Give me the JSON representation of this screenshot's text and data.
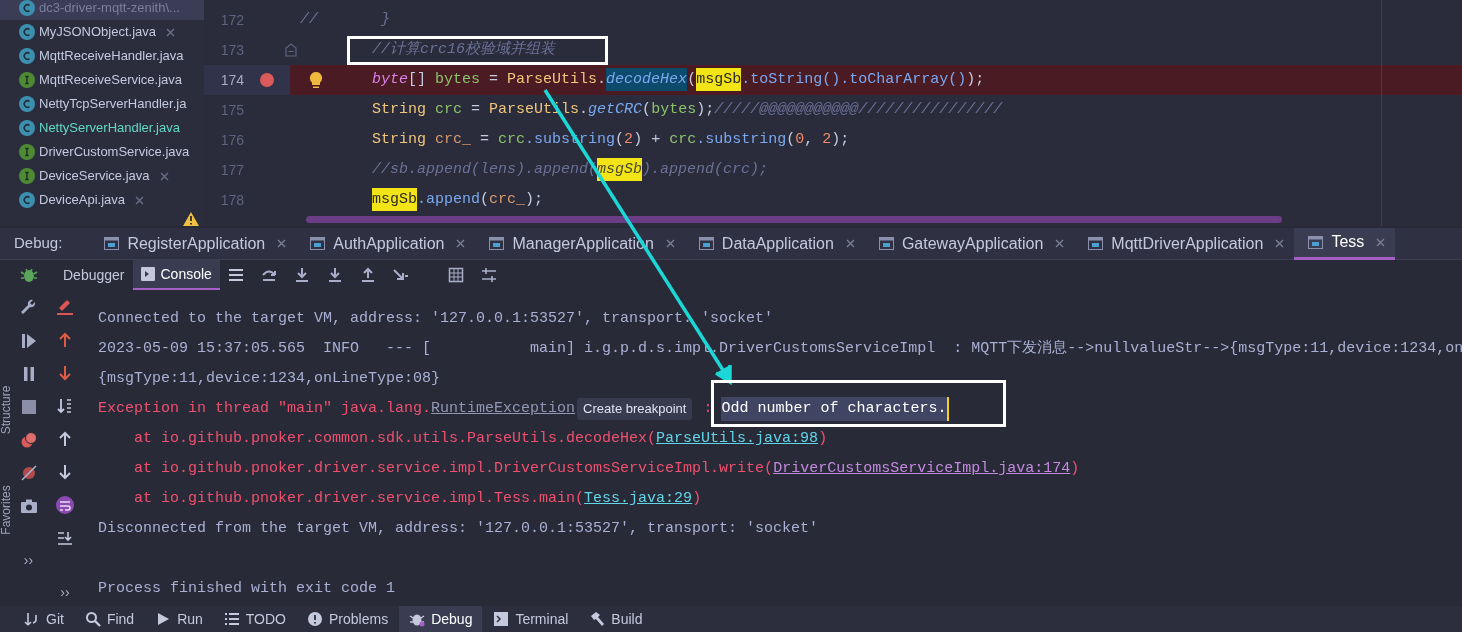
{
  "files": [
    {
      "name": "dc3-driver-mqtt-zenith\\...",
      "interface": false,
      "selected": true,
      "modified": false,
      "close": false
    },
    {
      "name": "MyJSONObject.java",
      "interface": false,
      "selected": false,
      "modified": false,
      "close": true
    },
    {
      "name": "MqttReceiveHandler.java",
      "interface": false,
      "selected": false,
      "modified": false,
      "close": false
    },
    {
      "name": "MqttReceiveService.java",
      "interface": true,
      "selected": false,
      "modified": false,
      "close": false
    },
    {
      "name": "NettyTcpServerHandler.ja",
      "interface": false,
      "selected": false,
      "modified": false,
      "close": false
    },
    {
      "name": "NettyServerHandler.java",
      "interface": false,
      "selected": false,
      "modified": true,
      "close": false
    },
    {
      "name": "DriverCustomService.java",
      "interface": true,
      "selected": false,
      "modified": false,
      "close": false
    },
    {
      "name": "DeviceService.java",
      "interface": true,
      "selected": false,
      "modified": false,
      "close": true
    },
    {
      "name": "DeviceApi.java",
      "interface": false,
      "selected": false,
      "modified": false,
      "close": true
    }
  ],
  "editor": {
    "lines": [
      {
        "number": "172",
        "breakpoint": false,
        "current": false,
        "fold": false,
        "bulb": false,
        "tokens": [
          {
            "kind": "cm",
            "text": "//       }"
          }
        ]
      },
      {
        "number": "173",
        "breakpoint": false,
        "current": false,
        "fold": true,
        "bulb": false,
        "tokens": [
          {
            "kind": "cm",
            "text": "        //计算crc16校验域并组装"
          }
        ]
      },
      {
        "number": "174",
        "breakpoint": true,
        "current": true,
        "fold": false,
        "bulb": true,
        "tokens": [
          {
            "kind": "kw",
            "text": "        byte"
          },
          {
            "kind": "p",
            "text": "[] "
          },
          {
            "kind": "var",
            "text": "bytes"
          },
          {
            "kind": "p",
            "text": " = "
          },
          {
            "kind": "cls",
            "text": "ParseUtils"
          },
          {
            "kind": "p",
            "text": "."
          },
          {
            "kind": "ref",
            "text": "decodeHex"
          },
          {
            "kind": "p",
            "text": "("
          },
          {
            "kind": "hl",
            "text": "msgSb"
          },
          {
            "kind": "fn",
            "text": ".toString().toCharArray()"
          },
          {
            "kind": "p",
            "text": ");"
          }
        ]
      },
      {
        "number": "175",
        "breakpoint": false,
        "current": false,
        "fold": false,
        "bulb": false,
        "tokens": [
          {
            "kind": "cls",
            "text": "        String "
          },
          {
            "kind": "var",
            "text": "crc"
          },
          {
            "kind": "p",
            "text": " = "
          },
          {
            "kind": "cls",
            "text": "ParseUtils"
          },
          {
            "kind": "p",
            "text": "."
          },
          {
            "kind": "call",
            "text": "getCRC"
          },
          {
            "kind": "p",
            "text": "("
          },
          {
            "kind": "var",
            "text": "bytes"
          },
          {
            "kind": "p",
            "text": ");"
          },
          {
            "kind": "cm",
            "text": "/////@@@@@@@@@@@////////////////"
          }
        ]
      },
      {
        "number": "176",
        "breakpoint": false,
        "current": false,
        "fold": false,
        "bulb": false,
        "tokens": [
          {
            "kind": "cls",
            "text": "        String "
          },
          {
            "kind": "var2",
            "text": "crc_"
          },
          {
            "kind": "p",
            "text": " = "
          },
          {
            "kind": "var",
            "text": "crc"
          },
          {
            "kind": "fn",
            "text": ".substring"
          },
          {
            "kind": "p",
            "text": "("
          },
          {
            "kind": "num",
            "text": "2"
          },
          {
            "kind": "p",
            "text": ") + "
          },
          {
            "kind": "var",
            "text": "crc"
          },
          {
            "kind": "fn",
            "text": ".substring"
          },
          {
            "kind": "p",
            "text": "("
          },
          {
            "kind": "num",
            "text": "0"
          },
          {
            "kind": "p",
            "text": ", "
          },
          {
            "kind": "num",
            "text": "2"
          },
          {
            "kind": "p",
            "text": ");"
          }
        ]
      },
      {
        "number": "177",
        "breakpoint": false,
        "current": false,
        "fold": false,
        "bulb": false,
        "tokens": [
          {
            "kind": "cm",
            "text": "        //sb.append(lens).append("
          },
          {
            "kind": "hlc",
            "text": "msgSb"
          },
          {
            "kind": "cm",
            "text": ").append(crc);"
          }
        ]
      },
      {
        "number": "178",
        "breakpoint": false,
        "current": false,
        "fold": false,
        "bulb": false,
        "tokens": [
          {
            "kind": "hl",
            "text": "        msgSb"
          },
          {
            "kind": "fn",
            "text": ".append"
          },
          {
            "kind": "p",
            "text": "("
          },
          {
            "kind": "var2",
            "text": "crc_"
          },
          {
            "kind": "p",
            "text": ");"
          }
        ]
      }
    ]
  },
  "debug": {
    "label": "Debug:",
    "tabs": [
      {
        "label": "RegisterApplication",
        "selected": false
      },
      {
        "label": "AuthApplication",
        "selected": false
      },
      {
        "label": "ManagerApplication",
        "selected": false
      },
      {
        "label": "DataApplication",
        "selected": false
      },
      {
        "label": "GatewayApplication",
        "selected": false
      },
      {
        "label": "MqttDriverApplication",
        "selected": false
      },
      {
        "label": "Tess",
        "selected": true
      }
    ],
    "subtabs": [
      {
        "label": "Debugger",
        "selected": false
      },
      {
        "label": "Console",
        "selected": true
      }
    ]
  },
  "console": {
    "lines": [
      {
        "parts": [
          {
            "kind": "text",
            "text": "Connected to the target VM, address: '127.0.0.1:53527', transport: 'socket'"
          }
        ]
      },
      {
        "parts": [
          {
            "kind": "text",
            "text": "2023-05-09 15:37:05.565  INFO   --- [           main] i.g.p.d.s.impl.DriverCustomsServiceImpl  : MQTT下发消息-->nullvalueStr-->{msgType:11,device:1234,on"
          }
        ]
      },
      {
        "parts": [
          {
            "kind": "text",
            "text": "{msgType:11,device:1234,onLineType:08}"
          }
        ]
      },
      {
        "parts": [
          {
            "kind": "error",
            "text": "Exception in thread \"main\" java.lang."
          },
          {
            "kind": "class_link",
            "text": "RuntimeException"
          },
          {
            "kind": "tooltip",
            "text": "Create breakpoint"
          },
          {
            "kind": "error",
            "text": " : "
          },
          {
            "kind": "selected",
            "text": "Odd number of characters."
          }
        ]
      },
      {
        "parts": [
          {
            "kind": "error",
            "text": "    at io.github.pnoker.common.sdk.utils.ParseUtils.decodeHex("
          },
          {
            "kind": "link",
            "text": "ParseUtils.java:98"
          },
          {
            "kind": "error",
            "text": ")"
          }
        ]
      },
      {
        "parts": [
          {
            "kind": "error",
            "text": "    at io.github.pnoker.driver.service.impl.DriverCustomsServiceImpl.write("
          },
          {
            "kind": "visited_link",
            "text": "DriverCustomsServiceImpl.java:174"
          },
          {
            "kind": "error",
            "text": ")"
          }
        ]
      },
      {
        "parts": [
          {
            "kind": "error",
            "text": "    at io.github.pnoker.driver.service.impl.Tess.main("
          },
          {
            "kind": "link",
            "text": "Tess.java:29"
          },
          {
            "kind": "error",
            "text": ")"
          }
        ]
      },
      {
        "parts": [
          {
            "kind": "text",
            "text": "Disconnected from the target VM, address: '127.0.0.1:53527', transport: 'socket'"
          }
        ]
      },
      {
        "parts": [
          {
            "kind": "text",
            "text": "Process finished with exit code 1"
          }
        ]
      }
    ]
  },
  "side_labels": [
    "Structure",
    "Favorites"
  ],
  "more": [
    "››",
    "››"
  ],
  "bottom_bar": [
    {
      "label": "Git",
      "selected": false
    },
    {
      "label": "Find",
      "selected": false
    },
    {
      "label": "Run",
      "selected": false
    },
    {
      "label": "TODO",
      "selected": false
    },
    {
      "label": "Problems",
      "selected": false
    },
    {
      "label": "Debug",
      "selected": true
    },
    {
      "label": "Terminal",
      "selected": false
    },
    {
      "label": "Build",
      "selected": false
    }
  ]
}
